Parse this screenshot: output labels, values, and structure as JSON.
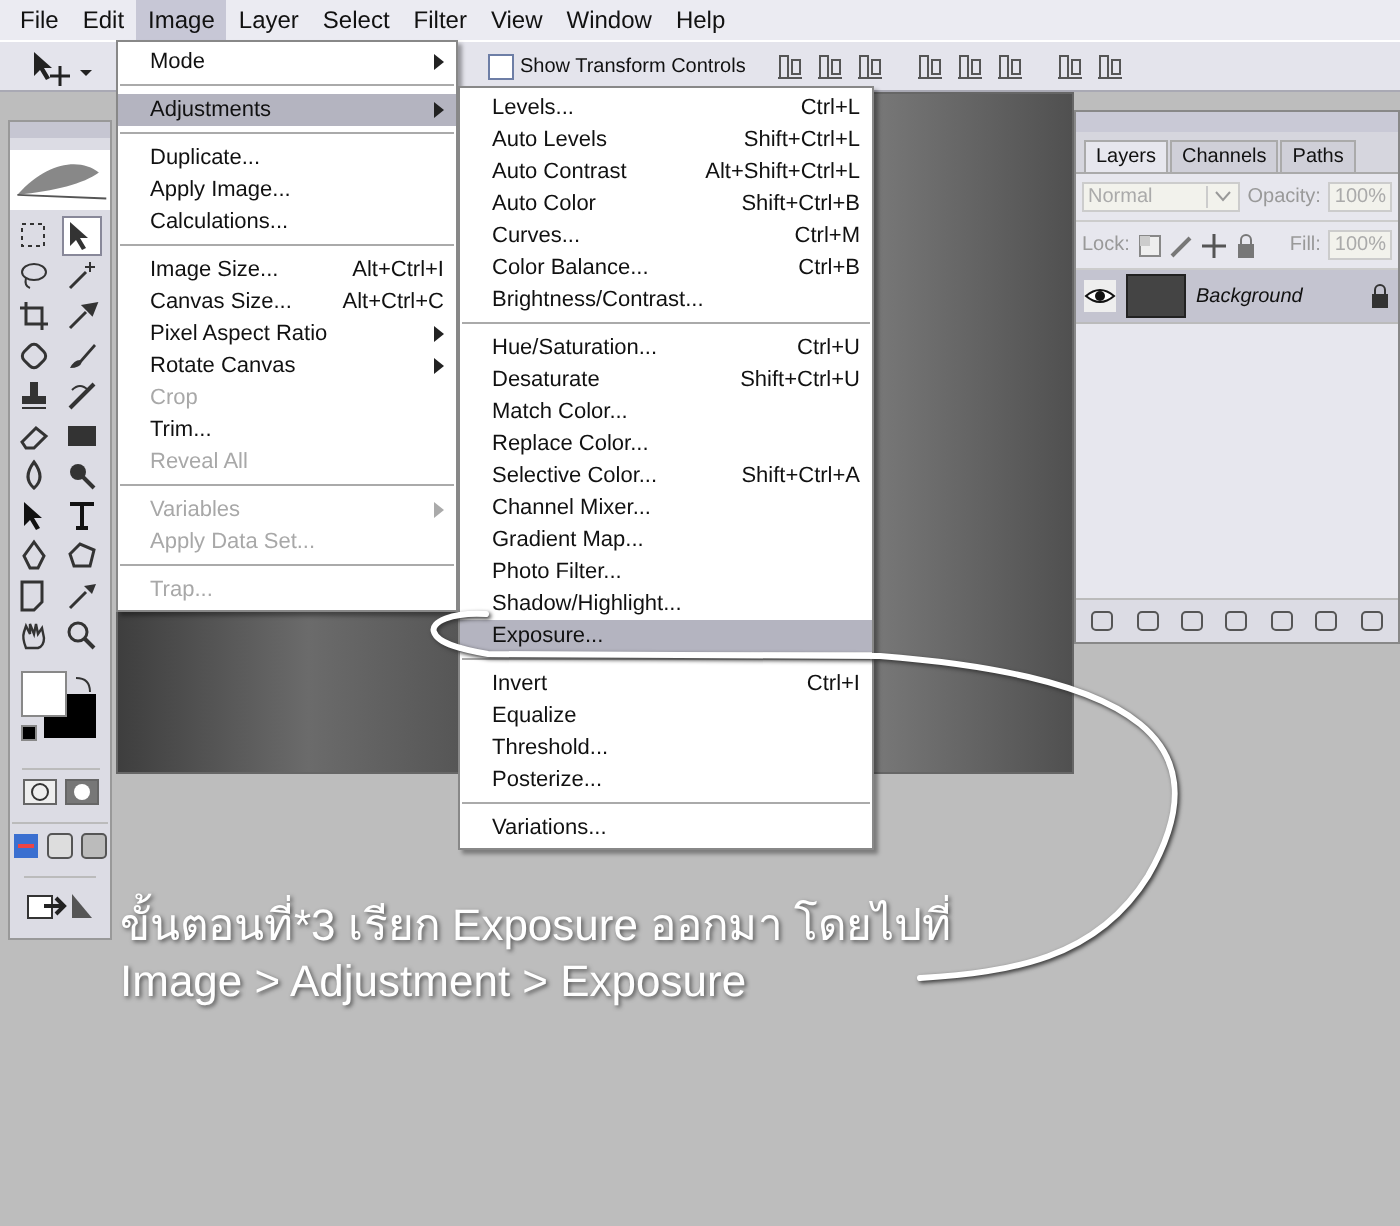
{
  "menu_bar": [
    {
      "label": "File",
      "selected": false
    },
    {
      "label": "Edit",
      "selected": false
    },
    {
      "label": "Image",
      "selected": true
    },
    {
      "label": "Layer",
      "selected": false
    },
    {
      "label": "Select",
      "selected": false
    },
    {
      "label": "Filter",
      "selected": false
    },
    {
      "label": "View",
      "selected": false
    },
    {
      "label": "Window",
      "selected": false
    },
    {
      "label": "Help",
      "selected": false
    }
  ],
  "options_bar": {
    "checkbox": {
      "label": "Show Transform Controls",
      "checked": false
    }
  },
  "image_menu": {
    "items": [
      {
        "kind": "item",
        "label": "Mode",
        "submenu": true,
        "disabled": false,
        "selected": false
      },
      {
        "kind": "separator"
      },
      {
        "kind": "item",
        "label": "Adjustments",
        "submenu": true,
        "disabled": false,
        "selected": true
      },
      {
        "kind": "separator"
      },
      {
        "kind": "item",
        "label": "Duplicate...",
        "disabled": false,
        "selected": false
      },
      {
        "kind": "item",
        "label": "Apply Image...",
        "disabled": false,
        "selected": false
      },
      {
        "kind": "item",
        "label": "Calculations...",
        "disabled": false,
        "selected": false
      },
      {
        "kind": "separator"
      },
      {
        "kind": "item",
        "label": "Image Size...",
        "shortcut": "Alt+Ctrl+I",
        "disabled": false,
        "selected": false
      },
      {
        "kind": "item",
        "label": "Canvas Size...",
        "shortcut": "Alt+Ctrl+C",
        "disabled": false,
        "selected": false
      },
      {
        "kind": "item",
        "label": "Pixel Aspect Ratio",
        "submenu": true,
        "disabled": false,
        "selected": false
      },
      {
        "kind": "item",
        "label": "Rotate Canvas",
        "submenu": true,
        "disabled": false,
        "selected": false
      },
      {
        "kind": "item",
        "label": "Crop",
        "disabled": true,
        "selected": false
      },
      {
        "kind": "item",
        "label": "Trim...",
        "disabled": false,
        "selected": false
      },
      {
        "kind": "item",
        "label": "Reveal All",
        "disabled": true,
        "selected": false
      },
      {
        "kind": "separator"
      },
      {
        "kind": "item",
        "label": "Variables",
        "submenu": true,
        "disabled": true,
        "selected": false
      },
      {
        "kind": "item",
        "label": "Apply Data Set...",
        "disabled": true,
        "selected": false
      },
      {
        "kind": "separator"
      },
      {
        "kind": "item",
        "label": "Trap...",
        "disabled": true,
        "selected": false
      }
    ]
  },
  "adjustments_menu": {
    "items": [
      {
        "kind": "item",
        "label": "Levels...",
        "shortcut": "Ctrl+L",
        "disabled": false,
        "selected": false
      },
      {
        "kind": "item",
        "label": "Auto Levels",
        "shortcut": "Shift+Ctrl+L",
        "disabled": false,
        "selected": false
      },
      {
        "kind": "item",
        "label": "Auto Contrast",
        "shortcut": "Alt+Shift+Ctrl+L",
        "disabled": false,
        "selected": false
      },
      {
        "kind": "item",
        "label": "Auto Color",
        "shortcut": "Shift+Ctrl+B",
        "disabled": false,
        "selected": false
      },
      {
        "kind": "item",
        "label": "Curves...",
        "shortcut": "Ctrl+M",
        "disabled": false,
        "selected": false
      },
      {
        "kind": "item",
        "label": "Color Balance...",
        "shortcut": "Ctrl+B",
        "disabled": false,
        "selected": false
      },
      {
        "kind": "item",
        "label": "Brightness/Contrast...",
        "disabled": false,
        "selected": false
      },
      {
        "kind": "separator"
      },
      {
        "kind": "item",
        "label": "Hue/Saturation...",
        "shortcut": "Ctrl+U",
        "disabled": false,
        "selected": false
      },
      {
        "kind": "item",
        "label": "Desaturate",
        "shortcut": "Shift+Ctrl+U",
        "disabled": false,
        "selected": false
      },
      {
        "kind": "item",
        "label": "Match Color...",
        "disabled": false,
        "selected": false
      },
      {
        "kind": "item",
        "label": "Replace Color...",
        "disabled": false,
        "selected": false
      },
      {
        "kind": "item",
        "label": "Selective Color...",
        "shortcut": "Shift+Ctrl+A",
        "disabled": false,
        "selected": false
      },
      {
        "kind": "item",
        "label": "Channel Mixer...",
        "disabled": false,
        "selected": false
      },
      {
        "kind": "item",
        "label": "Gradient Map...",
        "disabled": false,
        "selected": false
      },
      {
        "kind": "item",
        "label": "Photo Filter...",
        "disabled": false,
        "selected": false
      },
      {
        "kind": "item",
        "label": "Shadow/Highlight...",
        "disabled": false,
        "selected": false
      },
      {
        "kind": "item",
        "label": "Exposure...",
        "disabled": false,
        "selected": true
      },
      {
        "kind": "separator"
      },
      {
        "kind": "item",
        "label": "Invert",
        "shortcut": "Ctrl+I",
        "disabled": false,
        "selected": false
      },
      {
        "kind": "item",
        "label": "Equalize",
        "disabled": false,
        "selected": false
      },
      {
        "kind": "item",
        "label": "Threshold...",
        "disabled": false,
        "selected": false
      },
      {
        "kind": "item",
        "label": "Posterize...",
        "disabled": false,
        "selected": false
      },
      {
        "kind": "separator"
      },
      {
        "kind": "item",
        "label": "Variations...",
        "disabled": false,
        "selected": false
      }
    ]
  },
  "layers_panel": {
    "tabs": [
      {
        "label": "Layers",
        "selected": true
      },
      {
        "label": "Channels",
        "selected": false
      },
      {
        "label": "Paths",
        "selected": false
      }
    ],
    "blend_mode": "Normal",
    "opacity_label": "Opacity:",
    "opacity": "100%",
    "lock_label": "Lock:",
    "fill_label": "Fill:",
    "fill": "100%",
    "layers": [
      {
        "name": "Background",
        "visible": true,
        "locked": true,
        "selected": true
      }
    ]
  },
  "caption": {
    "line_1": "ขั้นตอนที่*3 เรียก Exposure ออกมา โดยไปที่",
    "line_2": "Image > Adjustment > Exposure"
  }
}
